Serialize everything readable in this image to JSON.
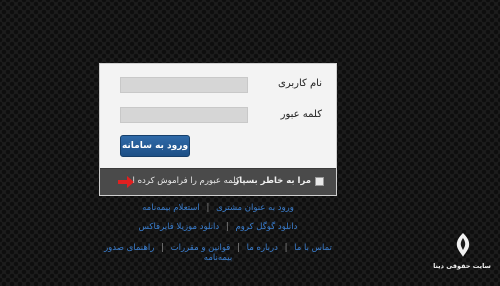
{
  "login": {
    "username_label": "نام کاربری",
    "password_label": "کلمه عبور",
    "username_value": "",
    "password_value": "",
    "submit_label": "ورود به سامانه",
    "remember_label": "مرا به خاطر بسپار",
    "forgot_label": "کلمه عبورم را فراموش کرده ام"
  },
  "links": {
    "customer_login": "ورود به عنوان مشتری",
    "policy_inquiry": "استعلام بیمه‌نامه",
    "download_chrome": "دانلود گوگل کروم",
    "download_firefox": "دانلود موزیلا فایرفاکس",
    "contact_us": "تماس با ما",
    "about_us": "درباره ما",
    "rules": "قوانین و مقررات",
    "issuance_guide": "راهنمای صدور بیمه‌نامه",
    "separator": "|"
  },
  "watermark": {
    "text": "سایت حقوقی دینا"
  },
  "colors": {
    "button": "#1d4f86",
    "link": "#3b7fd0",
    "arrow": "#e02020",
    "bar": "#4a4a4a"
  },
  "icons": {
    "arrow": "red-right-arrow-icon",
    "logo": "dina-logo-icon"
  }
}
